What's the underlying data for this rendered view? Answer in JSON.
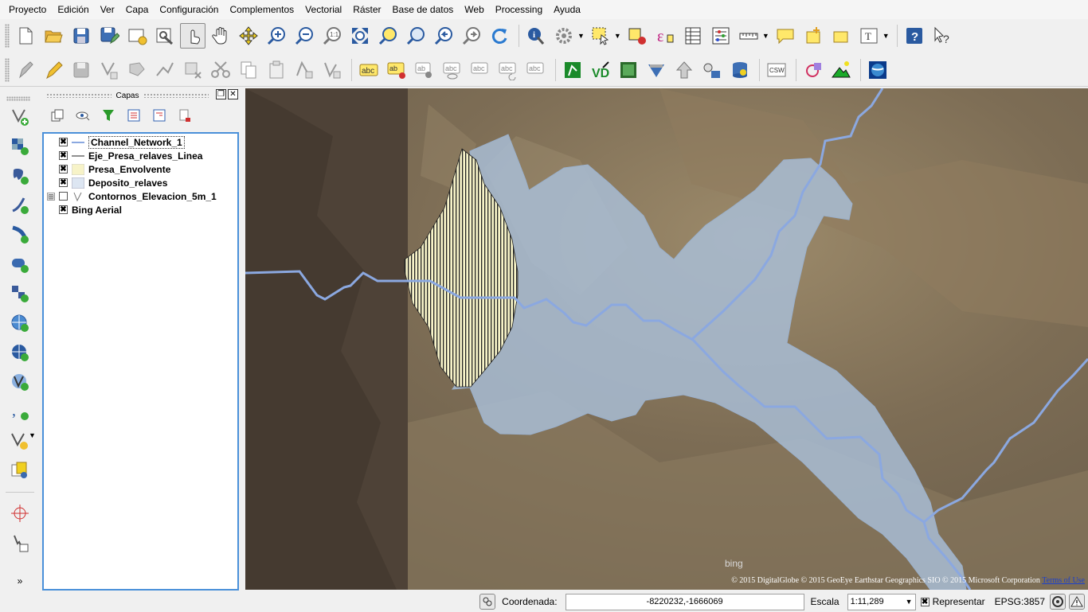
{
  "menu": [
    "Proyecto",
    "Edición",
    "Ver",
    "Capa",
    "Configuración",
    "Complementos",
    "Vectorial",
    "Ráster",
    "Base de datos",
    "Web",
    "Processing",
    "Ayuda"
  ],
  "toolbar1_icons": [
    "new-project-icon",
    "open-project-icon",
    "save-project-icon",
    "save-as-icon",
    "new-print-composer-icon",
    "composer-manager-icon",
    "touch-zoom-pan-icon",
    "pan-icon",
    "pan-to-selection-icon",
    "zoom-in-icon",
    "zoom-out-icon",
    "zoom-native-icon",
    "zoom-full-icon",
    "zoom-to-selection-icon",
    "zoom-to-layer-icon",
    "zoom-last-icon",
    "zoom-next-icon",
    "refresh-icon",
    "identify-icon",
    "action-icon",
    "select-features-icon",
    "deselect-icon",
    "expression-select-icon",
    "attribute-table-icon",
    "statistics-icon",
    "measure-icon",
    "map-tips-icon",
    "new-bookmark-icon",
    "show-bookmarks-icon",
    "text-annotation-icon",
    "help-icon",
    "whats-this-icon"
  ],
  "toolbar2_icons": [
    "current-edits-icon",
    "toggle-editing-icon",
    "save-edits-icon",
    "add-feature-icon",
    "move-feature-icon",
    "node-tool-icon",
    "delete-selected-icon",
    "cut-features-icon",
    "copy-features-icon",
    "paste-features-icon",
    "undo-icon",
    "redo-icon",
    "label-icon",
    "label-pin-icon",
    "label-highlight-icon",
    "label-show-hide-icon",
    "label-move-icon",
    "label-rotate-icon",
    "label-change-icon",
    "grass-icon",
    "vd-icon",
    "raster-icon",
    "wms-icon",
    "db-icon",
    "gps-icon",
    "spatialite-icon",
    "csw-icon",
    "georeferencer-icon",
    "terrain-icon",
    "globe-icon"
  ],
  "left_toolbar_icons": [
    "add-vector-layer-icon",
    "add-raster-layer-icon",
    "add-postgis-layer-icon",
    "add-spatialite-layer-icon",
    "add-mssql-layer-icon",
    "add-oracle-layer-icon",
    "add-db2-layer-icon",
    "add-wms-layer-icon",
    "add-wcs-layer-icon",
    "add-wfs-layer-icon",
    "add-delimited-text-icon",
    "new-shapefile-layer-icon",
    "new-spatialite-layer-icon",
    "coordinate-capture-icon",
    "gps-tools-icon"
  ],
  "layers_panel": {
    "title": "Capas",
    "layers": [
      {
        "name": "Channel_Network_1",
        "checked": true,
        "symbol": "line-blue",
        "selected": true,
        "expander": false
      },
      {
        "name": "Eje_Presa_relaves_Linea",
        "checked": true,
        "symbol": "line-black",
        "selected": false,
        "expander": false
      },
      {
        "name": "Presa_Envolvente",
        "checked": true,
        "symbol": "fill-yellow",
        "selected": false,
        "expander": false
      },
      {
        "name": "Deposito_relaves",
        "checked": true,
        "symbol": "fill-blue",
        "selected": false,
        "expander": false
      },
      {
        "name": "Contornos_Elevacion_5m_1",
        "checked": false,
        "symbol": "vertex-icon",
        "selected": false,
        "expander": true
      },
      {
        "name": "Bing Aerial",
        "checked": true,
        "symbol": "none",
        "selected": false,
        "expander": false
      }
    ]
  },
  "map": {
    "bing_logo": "bing",
    "copyright": "© 2015 DigitalGlobe © 2015 GeoEye Earthstar Geographics SIO © 2015 Microsoft Corporation",
    "terms": "Terms of Use",
    "colors": {
      "deposit_fill": "#a9bfd9",
      "channel_line": "#8ba8e0",
      "dam_fill": "#f7f3c8"
    }
  },
  "statusbar": {
    "coord_label": "Coordenada:",
    "coord_value": "-8220232,-1666069",
    "scale_label": "Escala",
    "scale_value": "1:11,289",
    "render_label": "Representar",
    "crs": "EPSG:3857"
  }
}
